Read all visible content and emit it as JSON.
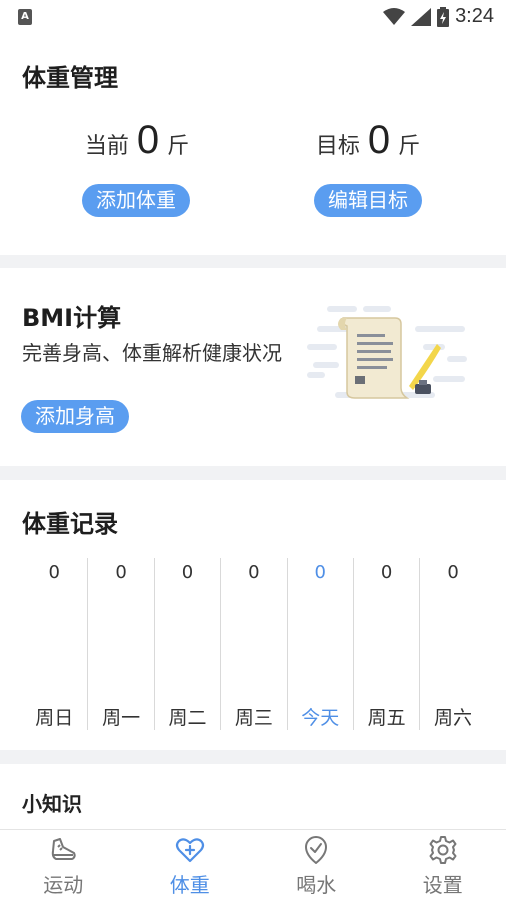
{
  "status_bar": {
    "time": "3:24",
    "notification_glyph": "A"
  },
  "weight_management": {
    "title": "体重管理",
    "current": {
      "label": "当前",
      "value": "0",
      "unit": "斤",
      "button": "添加体重"
    },
    "target": {
      "label": "目标",
      "value": "0",
      "unit": "斤",
      "button": "编辑目标"
    }
  },
  "bmi": {
    "title": "BMI计算",
    "description": "完善身高、体重解析健康状况",
    "button": "添加身高"
  },
  "records": {
    "title": "体重记录",
    "days": [
      {
        "label": "周日",
        "value": "0"
      },
      {
        "label": "周一",
        "value": "0"
      },
      {
        "label": "周二",
        "value": "0"
      },
      {
        "label": "周三",
        "value": "0"
      },
      {
        "label": "今天",
        "value": "0"
      },
      {
        "label": "周五",
        "value": "0"
      },
      {
        "label": "周六",
        "value": "0"
      }
    ]
  },
  "tips": {
    "title": "小知识"
  },
  "nav": {
    "items": [
      {
        "label": "运动",
        "icon": "shoe-icon"
      },
      {
        "label": "体重",
        "icon": "heart-plus-icon"
      },
      {
        "label": "喝水",
        "icon": "check-badge-icon"
      },
      {
        "label": "设置",
        "icon": "gear-icon"
      }
    ],
    "active_index": 1
  },
  "colors": {
    "accent": "#5a9df0",
    "background": "#f1f2f4",
    "text": "#222222"
  }
}
